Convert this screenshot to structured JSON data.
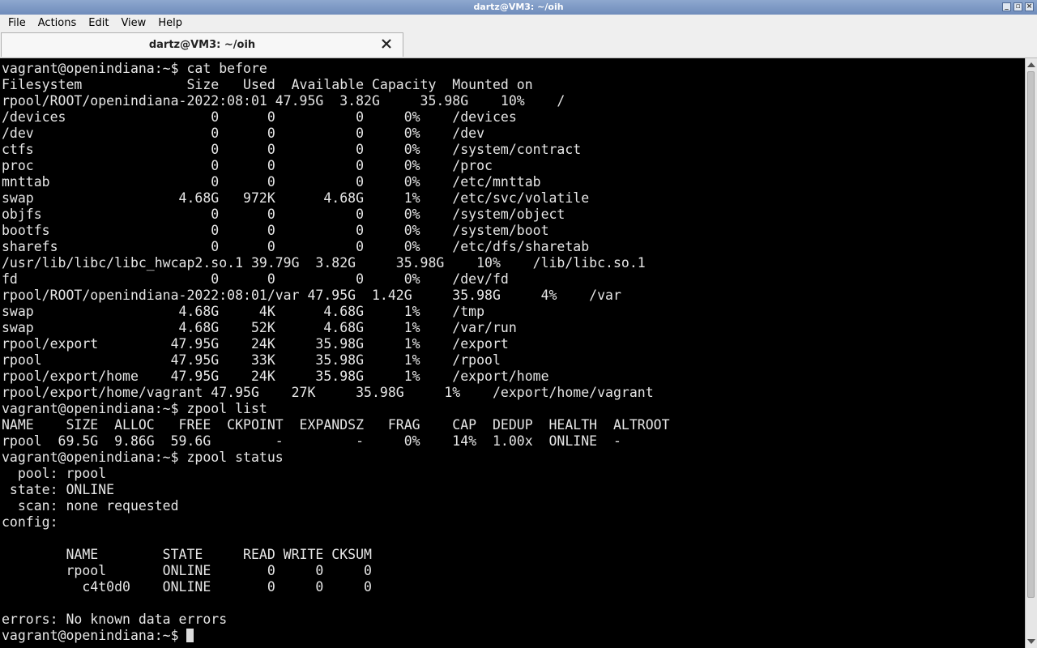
{
  "window": {
    "title": "dartz@VM3: ~/oih",
    "controls": [
      "minimize-icon",
      "maximize-icon",
      "close-icon"
    ],
    "titlebar_color": "#7a96c4"
  },
  "menubar": {
    "items": [
      "File",
      "Actions",
      "Edit",
      "View",
      "Help"
    ]
  },
  "tabs": [
    {
      "label": "dartz@VM3: ~/oih",
      "close_icon": "close-x-icon"
    }
  ],
  "terminal": {
    "background": "#000000",
    "foreground": "#e6e6e6",
    "lines": [
      "vagrant@openindiana:~$ cat before",
      "Filesystem             Size   Used  Available Capacity  Mounted on",
      "rpool/ROOT/openindiana-2022:08:01 47.95G  3.82G     35.98G    10%    /",
      "/devices                  0      0          0     0%    /devices",
      "/dev                      0      0          0     0%    /dev",
      "ctfs                      0      0          0     0%    /system/contract",
      "proc                      0      0          0     0%    /proc",
      "mnttab                    0      0          0     0%    /etc/mnttab",
      "swap                  4.68G   972K      4.68G     1%    /etc/svc/volatile",
      "objfs                     0      0          0     0%    /system/object",
      "bootfs                    0      0          0     0%    /system/boot",
      "sharefs                   0      0          0     0%    /etc/dfs/sharetab",
      "/usr/lib/libc/libc_hwcap2.so.1 39.79G  3.82G     35.98G    10%    /lib/libc.so.1",
      "fd                        0      0          0     0%    /dev/fd",
      "rpool/ROOT/openindiana-2022:08:01/var 47.95G  1.42G     35.98G     4%    /var",
      "swap                  4.68G     4K      4.68G     1%    /tmp",
      "swap                  4.68G    52K      4.68G     1%    /var/run",
      "rpool/export         47.95G    24K     35.98G     1%    /export",
      "rpool                47.95G    33K     35.98G     1%    /rpool",
      "rpool/export/home    47.95G    24K     35.98G     1%    /export/home",
      "rpool/export/home/vagrant 47.95G    27K     35.98G     1%    /export/home/vagrant",
      "vagrant@openindiana:~$ zpool list",
      "NAME    SIZE  ALLOC   FREE  CKPOINT  EXPANDSZ   FRAG    CAP  DEDUP  HEALTH  ALTROOT",
      "rpool  69.5G  9.86G  59.6G        -         -     0%    14%  1.00x  ONLINE  -",
      "vagrant@openindiana:~$ zpool status",
      "  pool: rpool",
      " state: ONLINE",
      "  scan: none requested",
      "config:",
      "",
      "        NAME        STATE     READ WRITE CKSUM",
      "        rpool       ONLINE       0     0     0",
      "          c4t0d0    ONLINE       0     0     0",
      "",
      "errors: No known data errors"
    ],
    "prompt": "vagrant@openindiana:~$ "
  },
  "scrollbar": {
    "up_icon": "scroll-up-arrow-icon",
    "down_icon": "scroll-down-arrow-icon"
  }
}
